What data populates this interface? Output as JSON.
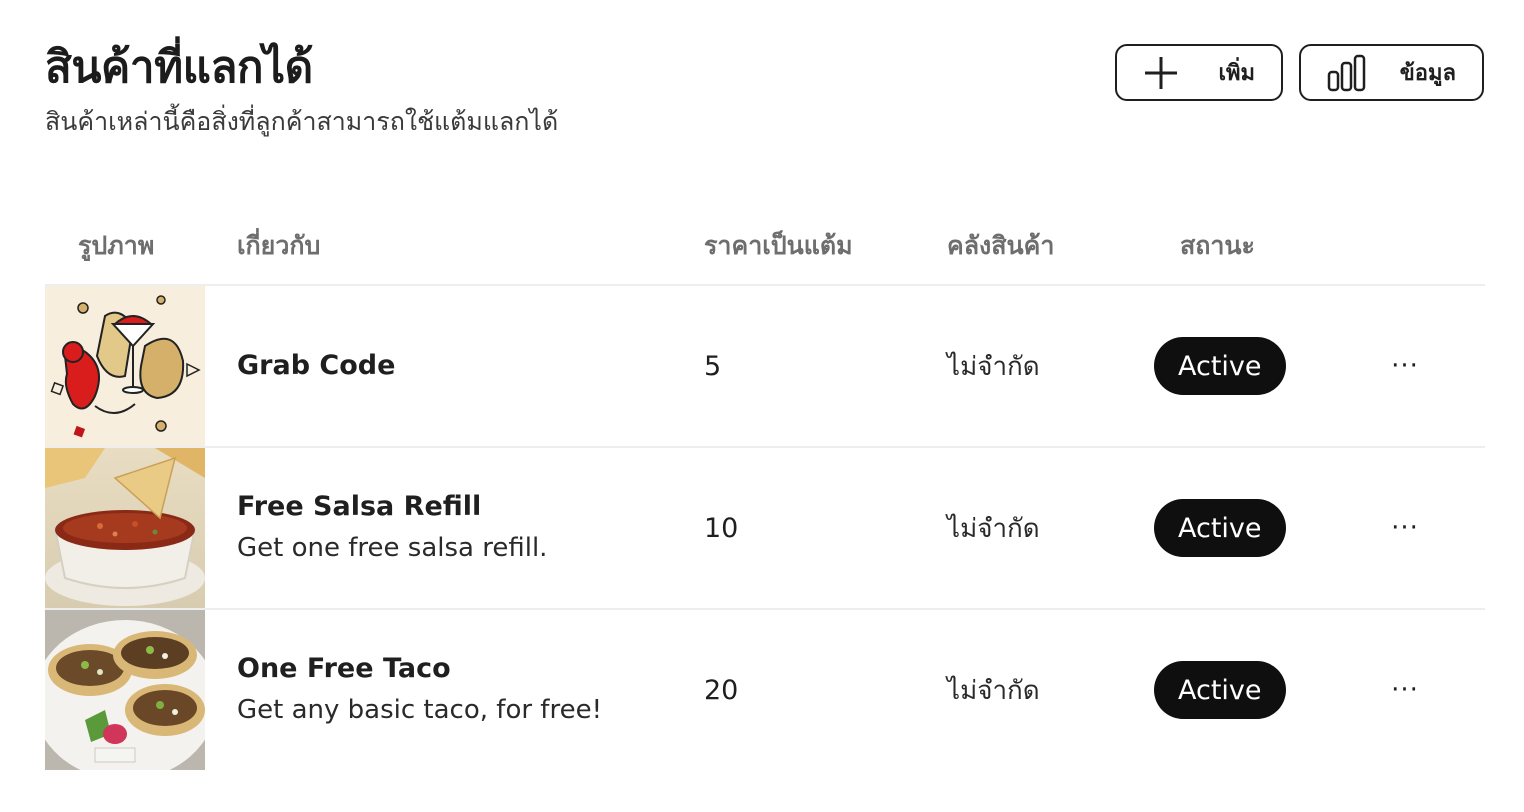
{
  "header": {
    "title": "สินค้าที่แลกได้",
    "subtitle": "สินค้าเหล่านี้คือสิ่งที่ลูกค้าสามารถใช้แต้มแลกได้"
  },
  "actions": {
    "add_label": "เพิ่ม",
    "add_icon": "plus-icon",
    "data_label": "ข้อมูล",
    "data_icon": "bar-chart-icon"
  },
  "table": {
    "columns": [
      "รูปภาพ",
      "เกี่ยวกับ",
      "ราคาเป็นแต้ม",
      "คลังสินค้า",
      "สถานะ"
    ],
    "rows": [
      {
        "name": "Grab Code",
        "description": "",
        "points": "5",
        "stock": "ไม่จำกัด",
        "status": "Active",
        "more": "···"
      },
      {
        "name": "Free Salsa Refill",
        "description": "Get one free salsa refill.",
        "points": "10",
        "stock": "ไม่จำกัด",
        "status": "Active",
        "more": "···"
      },
      {
        "name": "One Free Taco",
        "description": "Get any basic taco, for free!",
        "points": "20",
        "stock": "ไม่จำกัด",
        "status": "Active",
        "more": "···"
      }
    ]
  },
  "colors": {
    "badge_bg": "#0f0f0f",
    "badge_text": "#ffffff",
    "header_text": "#6e6e6e"
  }
}
